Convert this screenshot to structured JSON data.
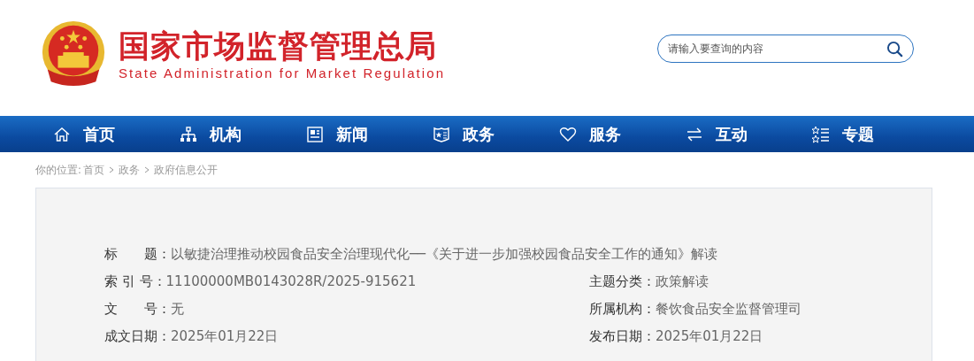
{
  "header": {
    "title": "国家市场监督管理总局",
    "subtitle": "State Administration for Market Regulation",
    "search": {
      "placeholder": "请输入要查询的内容"
    }
  },
  "nav": [
    {
      "label": "首页",
      "kind": "home"
    },
    {
      "label": "机构",
      "kind": "org"
    },
    {
      "label": "新闻",
      "kind": "news"
    },
    {
      "label": "政务",
      "kind": "gov"
    },
    {
      "label": "服务",
      "kind": "heart"
    },
    {
      "label": "互动",
      "kind": "swap"
    },
    {
      "label": "专题",
      "kind": "topic"
    }
  ],
  "breadcrumb": {
    "prefix": "你的位置:",
    "items": [
      "首页",
      "政务",
      "政府信息公开"
    ]
  },
  "meta": {
    "title": {
      "label": "标　　题：",
      "value": "以敏捷治理推动校园食品安全治理现代化──《关于进一步加强校园食品安全工作的通知》解读"
    },
    "rows": [
      [
        {
          "label": "索 引 号：",
          "value": "11100000MB0143028R/2025-915621"
        },
        {
          "label": "主题分类：",
          "value": "政策解读"
        }
      ],
      [
        {
          "label": "文　　号：",
          "value": "无"
        },
        {
          "label": "所属机构：",
          "value": "餐饮食品安全监督管理司"
        }
      ],
      [
        {
          "label": "成文日期：",
          "value": "2025年01月22日"
        },
        {
          "label": "发布日期：",
          "value": "2025年01月22日"
        }
      ]
    ]
  }
}
